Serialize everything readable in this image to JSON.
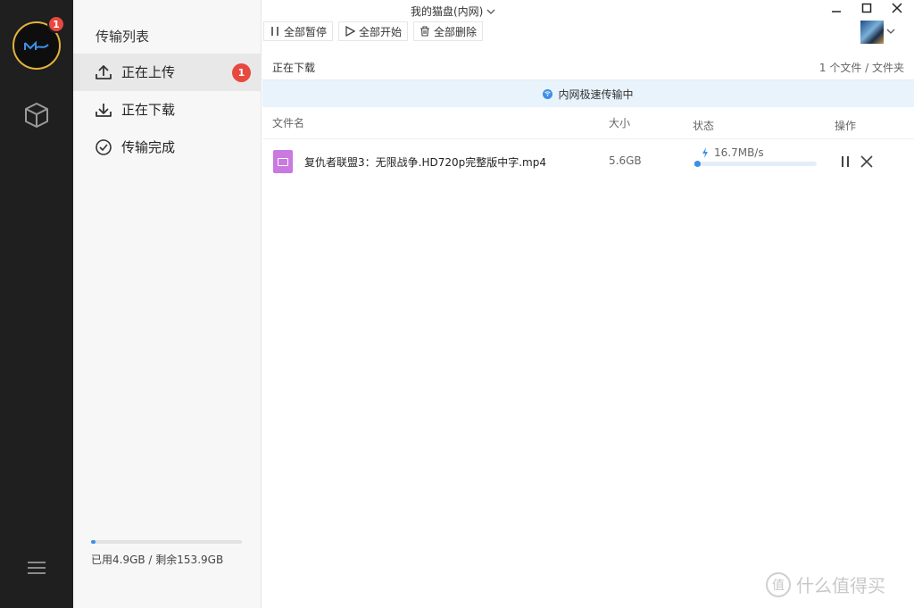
{
  "window": {
    "title": "我的猫盘(内网)"
  },
  "rail": {
    "badge_count": "1"
  },
  "sidebar": {
    "title": "传输列表",
    "items": [
      {
        "label": "正在上传",
        "badge": "1",
        "icon": "upload-icon",
        "active": true
      },
      {
        "label": "正在下载",
        "icon": "download-icon",
        "active": false
      },
      {
        "label": "传输完成",
        "icon": "check-circle-icon",
        "active": false
      }
    ],
    "storage": {
      "text": "已用4.9GB / 剩余153.9GB",
      "used_fraction": 0.031
    }
  },
  "toolbar": {
    "pause_all": "全部暂停",
    "start_all": "全部开始",
    "delete_all": "全部删除"
  },
  "main": {
    "title": "正在下载",
    "count": "1 个文件 / 文件夹",
    "banner": "内网极速传输中",
    "columns": {
      "name": "文件名",
      "size": "大小",
      "status": "状态",
      "action": "操作"
    },
    "rows": [
      {
        "file_name": "复仇者联盟3：无限战争.HD720p完整版中字.mp4",
        "size": "5.6GB",
        "speed": "16.7MB/s",
        "progress": 0.02
      }
    ]
  },
  "watermark": {
    "text": "什么值得买",
    "glyph": "值"
  },
  "colors": {
    "accent": "#3c8fe6",
    "badge": "#e8483f",
    "rail": "#1f1f1f",
    "banner_bg": "#e8f3fc",
    "file_icon": "#c979e0"
  }
}
